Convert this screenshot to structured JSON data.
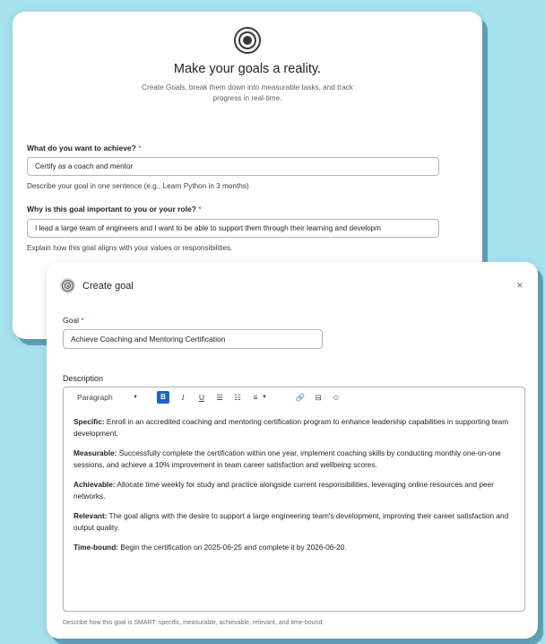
{
  "intro": {
    "title": "Make your goals a reality.",
    "subtitle": "Create Goals, break them down into measurable tasks, and track progress in real-time.",
    "fields": [
      {
        "label": "What do you want to achieve?",
        "required": "*",
        "value": "Certify as a coach and mentor",
        "hint": "Describe your goal in one sentence (e.g., Learn Python in 3 months)"
      },
      {
        "label": "Why is this goal important to you or your role?",
        "required": "*",
        "value": "I lead a large team of engineers and I want to be able to support them through their learning and developm",
        "hint": "Explain how this goal aligns with your values or responsibilities."
      }
    ]
  },
  "dialog": {
    "title": "Create goal",
    "close_icon": "×",
    "goal_label": "Goal",
    "goal_required": "*",
    "goal_value": "Achieve Coaching and Mentoring Certification",
    "description_label": "Description",
    "toolbar": {
      "paragraph": "Paragraph",
      "caret": "▼",
      "bold": "B",
      "italic": "I",
      "underline": "U",
      "bullets": "☰",
      "numbers": "☷",
      "align": "≡",
      "link": "🔗",
      "table": "⊟",
      "emoji": "☺"
    },
    "smart": [
      {
        "key": "Specific:",
        "text": " Enroll in an accredited coaching and mentoring certification program to enhance leadership capabilities in supporting team development."
      },
      {
        "key": "Measurable:",
        "text": " Successfully complete the certification within one year, implement coaching skills by conducting monthly one-on-one sessions, and achieve a 10% improvement in team career satisfaction and wellbeing scores."
      },
      {
        "key": "Achievable:",
        "text": " Allocate time weekly for study and practice alongside current responsibilities, leveraging online resources and peer networks."
      },
      {
        "key": "Relevant:",
        "text": " The goal aligns with the desire to support a large engineering team's development, improving their career satisfaction and output quality."
      },
      {
        "key": "Time-bound:",
        "text": " Begin the certification on 2025-06-25 and complete it by 2026-06-20."
      }
    ],
    "description_hint": "Describe how this goal is SMART: specific, measurable, achievable, relevant, and time-bound."
  },
  "colors": {
    "background": "#a6e1ee",
    "accent": "#1a66c9",
    "required": "#c4314b"
  }
}
